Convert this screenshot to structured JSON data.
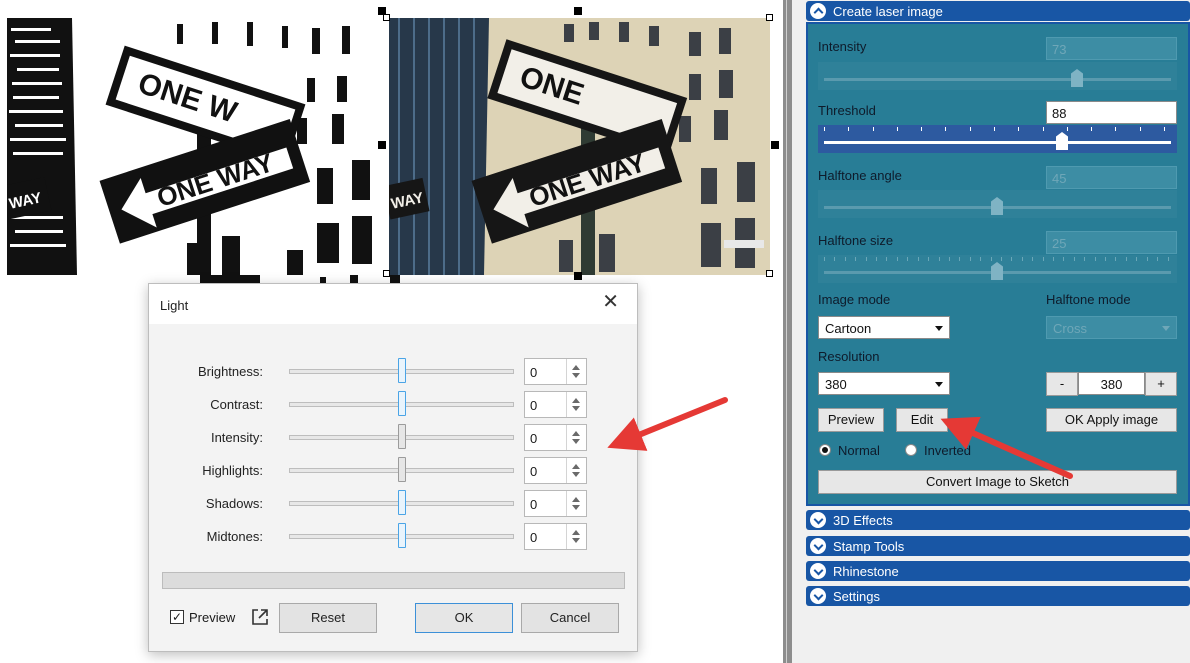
{
  "canvas": {
    "image_bw": {
      "sign_top": "ONE W",
      "sign_bottom": "ONE WAY",
      "sign_left": "WAY"
    },
    "image_color": {
      "sign_top": "ONE",
      "sign_bottom": "ONE WAY",
      "sign_left": "WAY"
    }
  },
  "dialog": {
    "title": "Light",
    "close_symbol": "✕",
    "sliders": [
      {
        "label": "Brightness:",
        "value": "0",
        "style": "active"
      },
      {
        "label": "Contrast:",
        "value": "0",
        "style": "active"
      },
      {
        "label": "Intensity:",
        "value": "0",
        "style": "grey"
      },
      {
        "label": "Highlights:",
        "value": "0",
        "style": "grey"
      },
      {
        "label": "Shadows:",
        "value": "0",
        "style": "active"
      },
      {
        "label": "Midtones:",
        "value": "0",
        "style": "active"
      }
    ],
    "preview_checked": "✓",
    "preview_label": "Preview",
    "reset_label": "Reset",
    "ok_label": "OK",
    "cancel_label": "Cancel"
  },
  "panel": {
    "laser_header": "Create laser image",
    "intensity_label": "Intensity",
    "intensity_value": "73",
    "threshold_label": "Threshold",
    "threshold_value": "88",
    "halftone_angle_label": "Halftone angle",
    "halftone_angle_value": "45",
    "halftone_size_label": "Halftone size",
    "halftone_size_value": "25",
    "image_mode_label": "Image mode",
    "image_mode_value": "Cartoon",
    "halftone_mode_label": "Halftone mode",
    "halftone_mode_value": "Cross",
    "resolution_label": "Resolution",
    "resolution_value": "380",
    "resolution_stepper_value": "380",
    "minus_label": "-",
    "plus_label": "+",
    "preview_button": "Preview",
    "edit_button": "Edit",
    "ok_apply_button": "OK Apply image",
    "radio_normal": "Normal",
    "radio_inverted": "Inverted",
    "convert_button": "Convert Image to Sketch",
    "sections": [
      "3D Effects",
      "Stamp Tools",
      "Rhinestone",
      "Settings"
    ]
  },
  "colors": {
    "header_blue": "#1856a5",
    "panel_teal": "#287d96",
    "annotation_red": "#e53935",
    "focus_blue": "#4aa4e6"
  }
}
